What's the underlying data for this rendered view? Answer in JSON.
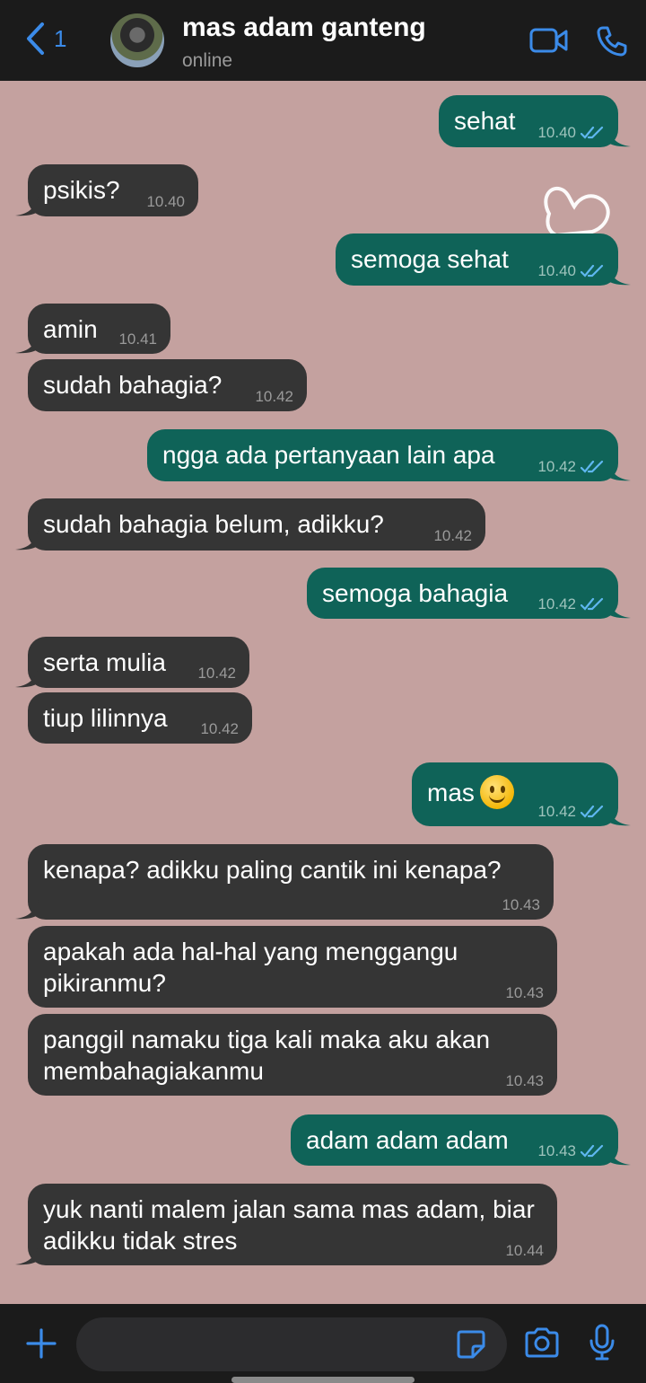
{
  "header": {
    "back_count": "1",
    "contact_name": "mas adam ganteng",
    "status": "online"
  },
  "colors": {
    "header_bg": "#1b1b1b",
    "chat_bg": "#c4a19f",
    "incoming_bubble": "#353535",
    "outgoing_bubble": "#0f6358",
    "accent_blue": "#3b8be9",
    "read_check": "#5fb7f0"
  },
  "messages": [
    {
      "direction": "out",
      "text": "sehat",
      "time": "10.40",
      "read": true
    },
    {
      "direction": "in",
      "text": "psikis?",
      "time": "10.40"
    },
    {
      "direction": "out",
      "text": "semoga sehat",
      "time": "10.40",
      "read": true
    },
    {
      "direction": "in",
      "text": "amin",
      "time": "10.41"
    },
    {
      "direction": "in",
      "text": "sudah bahagia?",
      "time": "10.42"
    },
    {
      "direction": "out",
      "text": "ngga ada pertanyaan lain apa",
      "time": "10.42",
      "read": true
    },
    {
      "direction": "in",
      "text": "sudah bahagia belum, adikku?",
      "time": "10.42"
    },
    {
      "direction": "out",
      "text": "semoga bahagia",
      "time": "10.42",
      "read": true
    },
    {
      "direction": "in",
      "text": "serta mulia",
      "time": "10.42"
    },
    {
      "direction": "in",
      "text": "tiup lilinnya",
      "time": "10.42"
    },
    {
      "direction": "out",
      "text": "mas",
      "emoji": "slightly-smiling-face",
      "time": "10.42",
      "read": true
    },
    {
      "direction": "in",
      "text": "kenapa? adikku paling cantik ini kenapa?",
      "time": "10.43"
    },
    {
      "direction": "in",
      "text": "apakah ada hal-hal yang menggangu pikiranmu?",
      "time": "10.43"
    },
    {
      "direction": "in",
      "text": "panggil namaku tiga kali maka aku akan membahagiakanmu",
      "time": "10.43"
    },
    {
      "direction": "out",
      "text": "adam adam adam",
      "time": "10.43",
      "read": true
    },
    {
      "direction": "in",
      "text": "yuk nanti malem jalan sama mas adam, biar adikku tidak stres",
      "time": "10.44"
    }
  ],
  "composer": {
    "value": "",
    "placeholder": ""
  },
  "icons": {
    "back": "chevron-left-icon",
    "video": "video-camera-icon",
    "call": "phone-icon",
    "plus": "plus-icon",
    "sticker": "sticker-icon",
    "camera": "camera-icon",
    "mic": "microphone-icon",
    "read_receipt": "double-check-icon"
  }
}
